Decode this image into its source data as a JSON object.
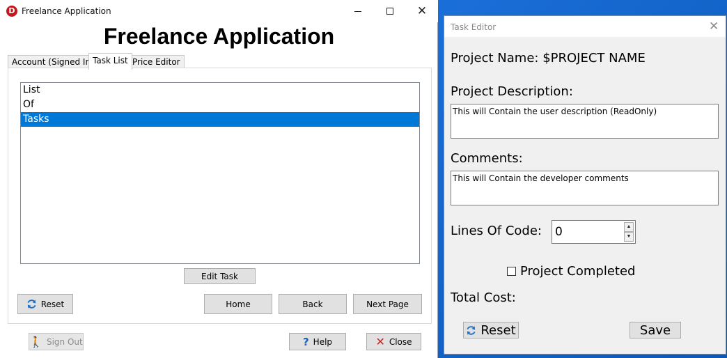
{
  "main_window": {
    "title": "Freelance Application",
    "app_icon_letter": "D",
    "heading": "Freelance Application",
    "controls": {
      "minimize": "—",
      "maximize": "☐",
      "close": "✕"
    },
    "tabs": [
      {
        "label": "Account (Signed In)",
        "active": false
      },
      {
        "label": "Task List",
        "active": true
      },
      {
        "label": "Price Editor",
        "active": false
      }
    ],
    "task_list": {
      "items": [
        "List",
        "Of",
        "Tasks"
      ],
      "selected_index": 2
    },
    "buttons": {
      "edit_task": "Edit Task",
      "reset": "Reset",
      "home": "Home",
      "back": "Back",
      "next_page": "Next Page",
      "sign_out": "Sign Out",
      "help": "Help",
      "close": "Close"
    }
  },
  "task_editor": {
    "title": "Task Editor",
    "close_glyph": "✕",
    "project_name": "Project Name: $PROJECT NAME",
    "description_label": "Project Description:",
    "description_value": "This will Contain the user description (ReadOnly)",
    "comments_label": "Comments:",
    "comments_value": "This will Contain the developer comments",
    "lines_of_code_label": "Lines Of Code:",
    "lines_of_code_value": "0",
    "completed_label": "Project Completed",
    "completed_checked": false,
    "total_cost_label": "Total Cost:",
    "buttons": {
      "reset": "Reset",
      "save": "Save"
    }
  },
  "icons": {
    "app": "app-logo-icon",
    "reset": "refresh-icon",
    "sign_out": "walking-person-icon",
    "help": "question-mark-icon",
    "close": "red-x-icon"
  },
  "colors": {
    "selection": "#0078d7",
    "desktop": "#0b5fc7",
    "app_icon": "#c4161c"
  }
}
